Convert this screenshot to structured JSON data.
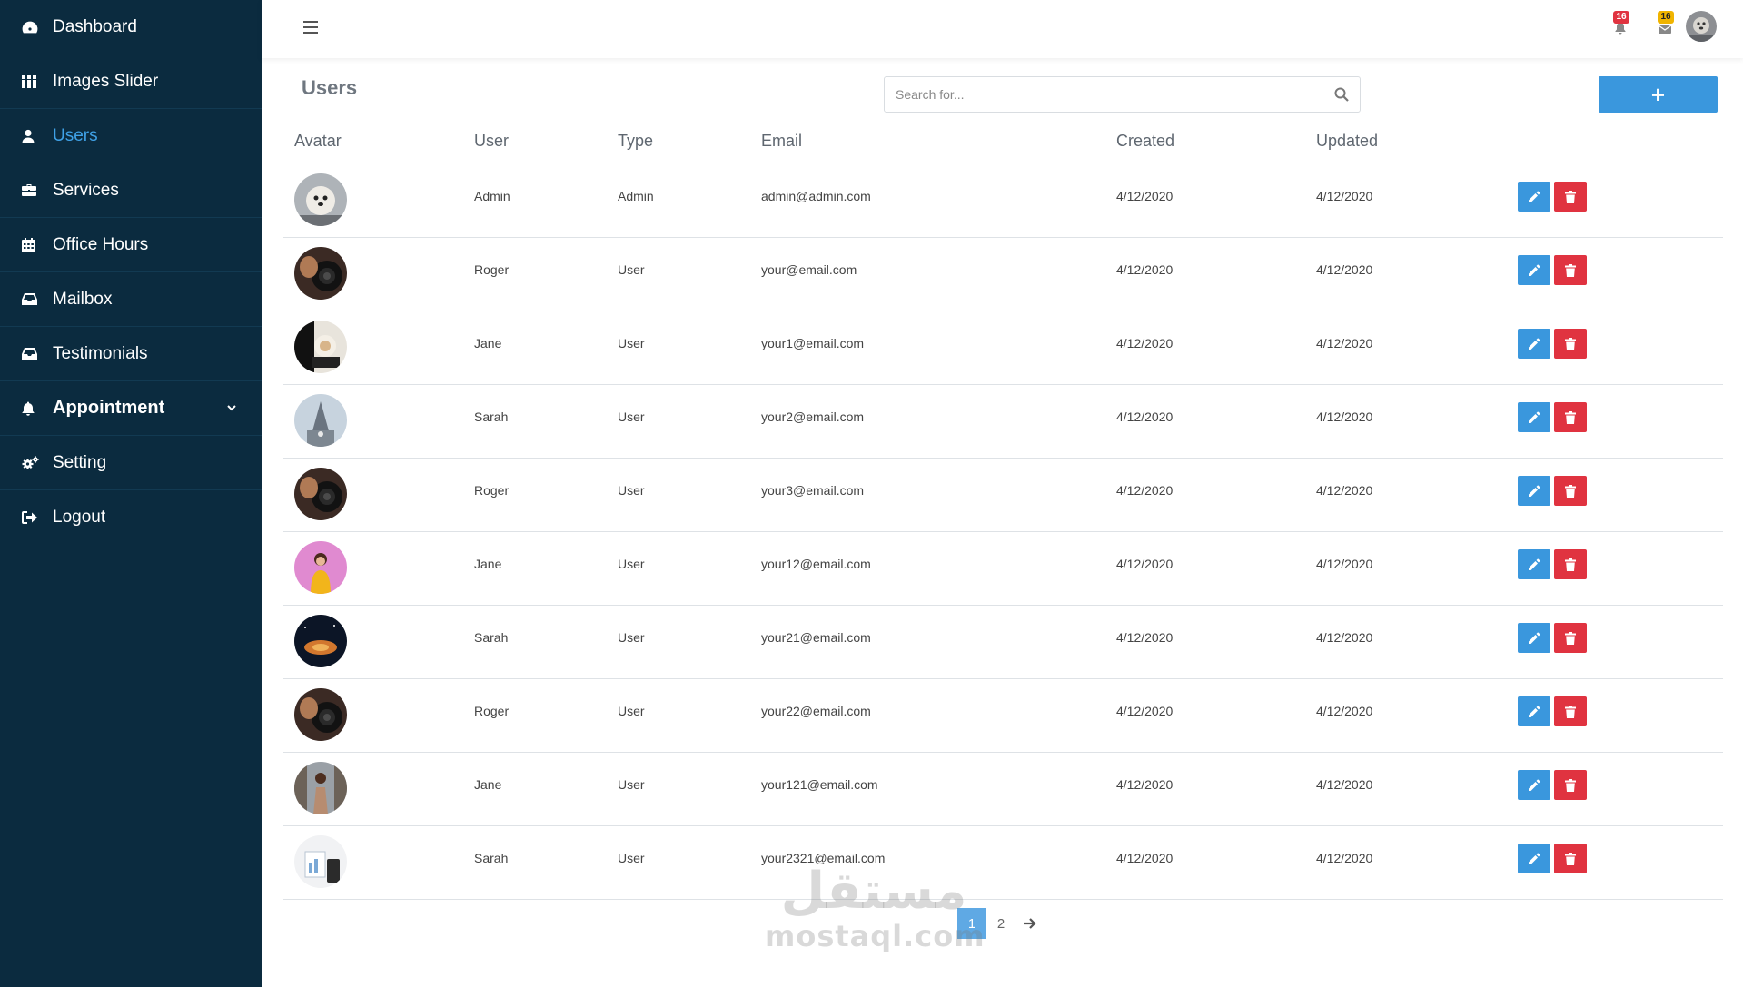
{
  "sidebar": {
    "items": [
      {
        "label": "Dashboard",
        "icon": "dashboard-icon"
      },
      {
        "label": "Images Slider",
        "icon": "grid-icon"
      },
      {
        "label": "Users",
        "icon": "user-icon",
        "active": true
      },
      {
        "label": "Services",
        "icon": "briefcase-icon"
      },
      {
        "label": "Office Hours",
        "icon": "calendar-icon"
      },
      {
        "label": "Mailbox",
        "icon": "inbox-icon"
      },
      {
        "label": "Testimonials",
        "icon": "inbox-icon"
      },
      {
        "label": "Appointment",
        "icon": "bell-icon",
        "expandable": true
      },
      {
        "label": "Setting",
        "icon": "cogs-icon"
      },
      {
        "label": "Logout",
        "icon": "sign-out-icon"
      }
    ]
  },
  "topbar": {
    "notifications_count": "16",
    "messages_count": "16"
  },
  "page": {
    "title": "Users",
    "search_placeholder": "Search for...",
    "add_button_label": "+"
  },
  "table": {
    "headers": [
      "Avatar",
      "User",
      "Type",
      "Email",
      "Created",
      "Updated"
    ],
    "rows": [
      {
        "user": "Admin",
        "type": "Admin",
        "email": "admin@admin.com",
        "created": "4/12/2020",
        "updated": "4/12/2020"
      },
      {
        "user": "Roger",
        "type": "User",
        "email": "your@email.com",
        "created": "4/12/2020",
        "updated": "4/12/2020"
      },
      {
        "user": "Jane",
        "type": "User",
        "email": "your1@email.com",
        "created": "4/12/2020",
        "updated": "4/12/2020"
      },
      {
        "user": "Sarah",
        "type": "User",
        "email": "your2@email.com",
        "created": "4/12/2020",
        "updated": "4/12/2020"
      },
      {
        "user": "Roger",
        "type": "User",
        "email": "your3@email.com",
        "created": "4/12/2020",
        "updated": "4/12/2020"
      },
      {
        "user": "Jane",
        "type": "User",
        "email": "your12@email.com",
        "created": "4/12/2020",
        "updated": "4/12/2020"
      },
      {
        "user": "Sarah",
        "type": "User",
        "email": "your21@email.com",
        "created": "4/12/2020",
        "updated": "4/12/2020"
      },
      {
        "user": "Roger",
        "type": "User",
        "email": "your22@email.com",
        "created": "4/12/2020",
        "updated": "4/12/2020"
      },
      {
        "user": "Jane",
        "type": "User",
        "email": "your121@email.com",
        "created": "4/12/2020",
        "updated": "4/12/2020"
      },
      {
        "user": "Sarah",
        "type": "User",
        "email": "your2321@email.com",
        "created": "4/12/2020",
        "updated": "4/12/2020"
      }
    ]
  },
  "pagination": {
    "pages": [
      "1",
      "2"
    ],
    "current": "1"
  },
  "watermark": {
    "arabic": "مستقل",
    "latin": "mostaql.com"
  },
  "colors": {
    "sidebar_bg": "#0b2b3f",
    "active_nav": "#3fa1e6",
    "primary": "#3a97dd",
    "danger": "#e03340"
  }
}
